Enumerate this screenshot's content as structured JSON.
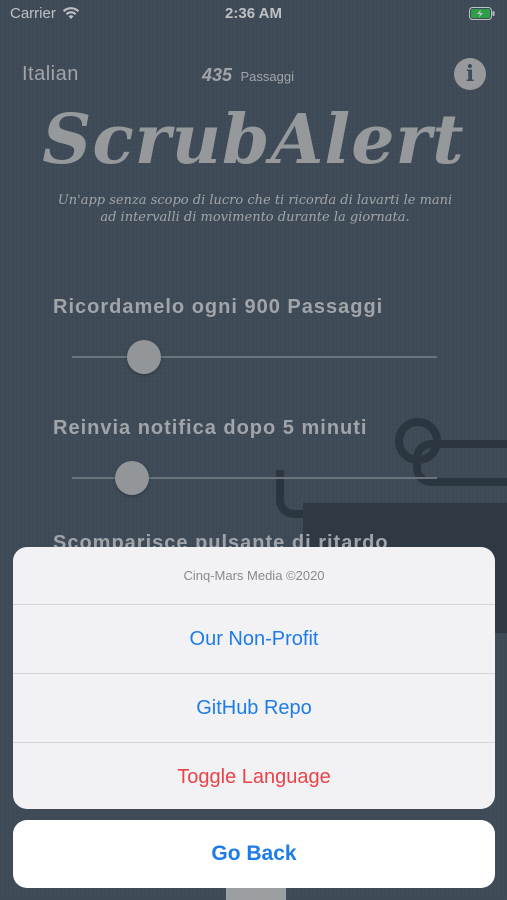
{
  "status_bar": {
    "carrier": "Carrier",
    "time": "2:36 AM"
  },
  "header": {
    "language": "Italian",
    "passages_count": "435",
    "passages_label": "Passaggi",
    "info_icon": "i"
  },
  "app": {
    "title": "ScrubAlert",
    "tagline": "Un'app senza scopo di lucro che ti ricorda di lavarti le mani ad intervalli di movimento durante la giornata."
  },
  "settings": {
    "remind_label": "Ricordamelo ogni 900 Passaggi",
    "renotify_label": "Reinvia notifica dopo 5 minuti",
    "partial_label": "Scomparisce pulsante di ritardo"
  },
  "action_sheet": {
    "title": "Cinq-Mars Media ©2020",
    "buttons": [
      {
        "label": "Our Non-Profit"
      },
      {
        "label": "GitHub Repo"
      },
      {
        "label": "Toggle Language"
      }
    ],
    "cancel": "Go Back"
  },
  "colors": {
    "background": "#4f5e6d",
    "action_blue": "#1d7ce6",
    "destructive_red": "#e9434a"
  }
}
